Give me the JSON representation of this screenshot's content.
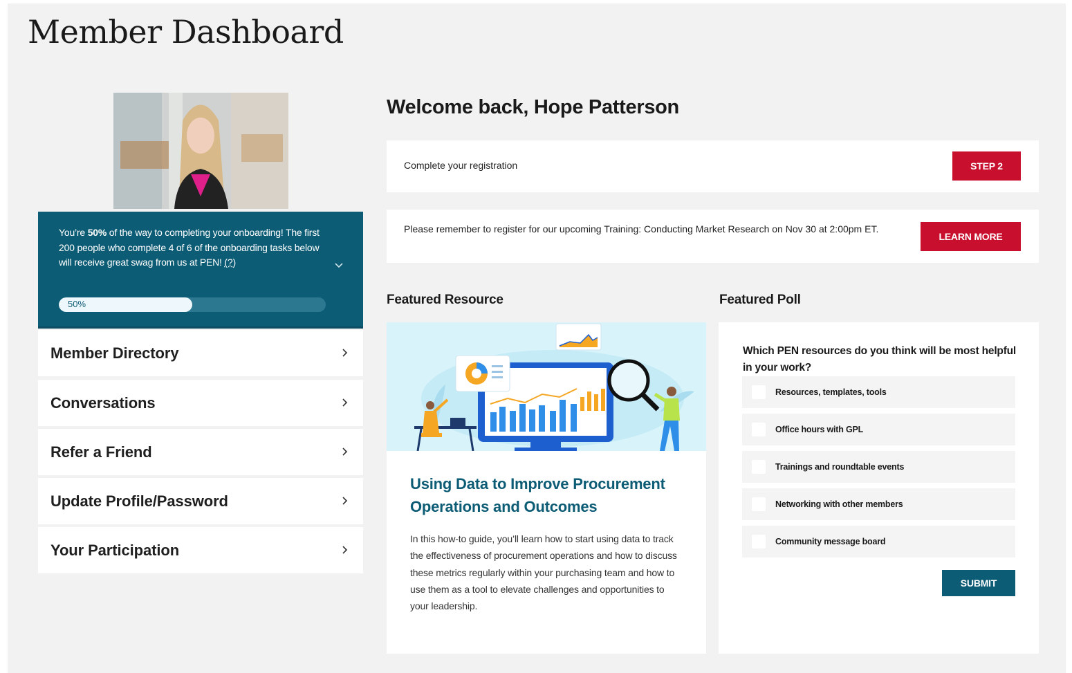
{
  "page": {
    "title": "Member Dashboard"
  },
  "profile": {
    "avatar_icon": "user-photo",
    "onboarding": {
      "text_prefix": "You’re ",
      "percent_bold": "50%",
      "text_rest": " of the way to completing your onboarding! The first 200 people who complete 4 of 6 of the onboarding tasks below will receive great swag from us at PEN! ",
      "help_marker": "(?)",
      "progress_label": "50%",
      "progress_value": 0.5,
      "expand_icon": "chevron-down-icon"
    }
  },
  "sidebar": {
    "items": [
      {
        "label": "Member Directory"
      },
      {
        "label": "Conversations"
      },
      {
        "label": "Refer a Friend"
      },
      {
        "label": "Update Profile/Password"
      },
      {
        "label": "Your Participation"
      }
    ]
  },
  "main": {
    "welcome": "Welcome back, Hope Patterson",
    "registration": {
      "text": "Complete your registration",
      "button": "STEP 2"
    },
    "training": {
      "text": "Please remember to register for our upcoming Training: Conducting Market Research on Nov 30 at 2:00pm ET.",
      "button": "LEARN MORE"
    },
    "featured_resource": {
      "heading": "Featured Resource",
      "title": "Using Data to Improve Procurement Operations and Outcomes",
      "description": "In this how-to guide, you’ll learn how to start using data to track the effectiveness of procurement operations and how to discuss these metrics regularly within your purchasing team and how to use them as a tool to elevate challenges and opportunities to your leadership."
    },
    "featured_poll": {
      "heading": "Featured Poll",
      "question": "Which PEN resources do you think will be most helpful in your work?",
      "options": [
        {
          "label": "Resources, templates, tools"
        },
        {
          "label": "Office hours with GPL"
        },
        {
          "label": "Trainings and roundtable events"
        },
        {
          "label": "Networking with other members"
        },
        {
          "label": "Community message board"
        }
      ],
      "submit": "SUBMIT"
    }
  },
  "colors": {
    "brand_teal": "#0d5c75",
    "accent_red": "#c8102e",
    "background": "#f2f2f2"
  }
}
